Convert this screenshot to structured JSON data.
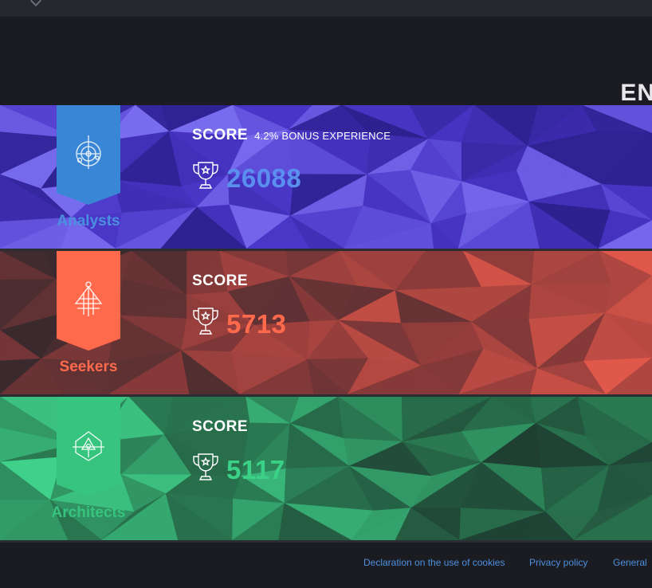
{
  "header": {
    "title": "EN"
  },
  "factions": [
    {
      "name": "Analysts",
      "score_label": "SCORE",
      "bonus": "4.2% BONUS EXPERIENCE",
      "score": "26088",
      "emblem": "analysts-emblem-icon",
      "colors": {
        "banner": "#3a86d6",
        "name": "#4a8fe0",
        "score": "#5a8ff0",
        "bg_base": "#4a36c8",
        "bg_light": "#7a6ef0",
        "bg_dark": "#2d2190"
      }
    },
    {
      "name": "Seekers",
      "score_label": "SCORE",
      "bonus": "",
      "score": "5713",
      "emblem": "seekers-emblem-icon",
      "colors": {
        "banner": "#ff6a4d",
        "name": "#ff6a4d",
        "score": "#ff6a4d",
        "bg_base": "#8a3a3a",
        "bg_light": "#e0584a",
        "bg_dark": "#3a2a2e"
      }
    },
    {
      "name": "Architects",
      "score_label": "SCORE",
      "bonus": "",
      "score": "5117",
      "emblem": "architects-emblem-icon",
      "colors": {
        "banner": "#37c47e",
        "name": "#37c47e",
        "score": "#3bd287",
        "bg_base": "#2a7a52",
        "bg_light": "#3fd08a",
        "bg_dark": "#1d3b30"
      }
    }
  ],
  "footer": {
    "links": [
      "Declaration on the use of cookies",
      "Privacy policy",
      "General"
    ],
    "link_color": "#4d8fe0"
  }
}
